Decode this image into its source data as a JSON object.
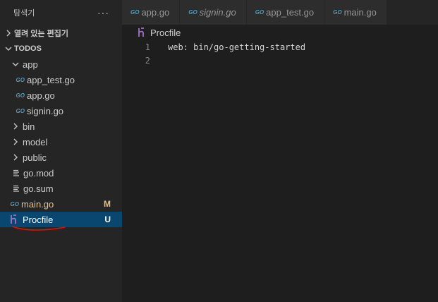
{
  "explorer": {
    "title": "탐색기",
    "more": "···",
    "open_editors": "열려 있는 편집기",
    "workspace": "TODOS"
  },
  "tree": {
    "app": "app",
    "app_test": "app_test.go",
    "app_go": "app.go",
    "signin": "signin.go",
    "bin": "bin",
    "model": "model",
    "public": "public",
    "gomod": "go.mod",
    "gosum": "go.sum",
    "main": "main.go",
    "main_badge": "M",
    "procfile": "Procfile",
    "procfile_badge": "U"
  },
  "tabs": [
    {
      "label": "app.go"
    },
    {
      "label": "signin.go"
    },
    {
      "label": "app_test.go"
    },
    {
      "label": "main.go"
    }
  ],
  "editor": {
    "breadcrumb": "Procfile",
    "lines": [
      {
        "num": "1",
        "text": "web: bin/go-getting-started"
      },
      {
        "num": "2",
        "text": ""
      }
    ]
  },
  "icons": {
    "go_glyph": "GO",
    "go_color": "#519aba",
    "heroku_color": "#a074c4",
    "annotation_color": "#e51400"
  }
}
